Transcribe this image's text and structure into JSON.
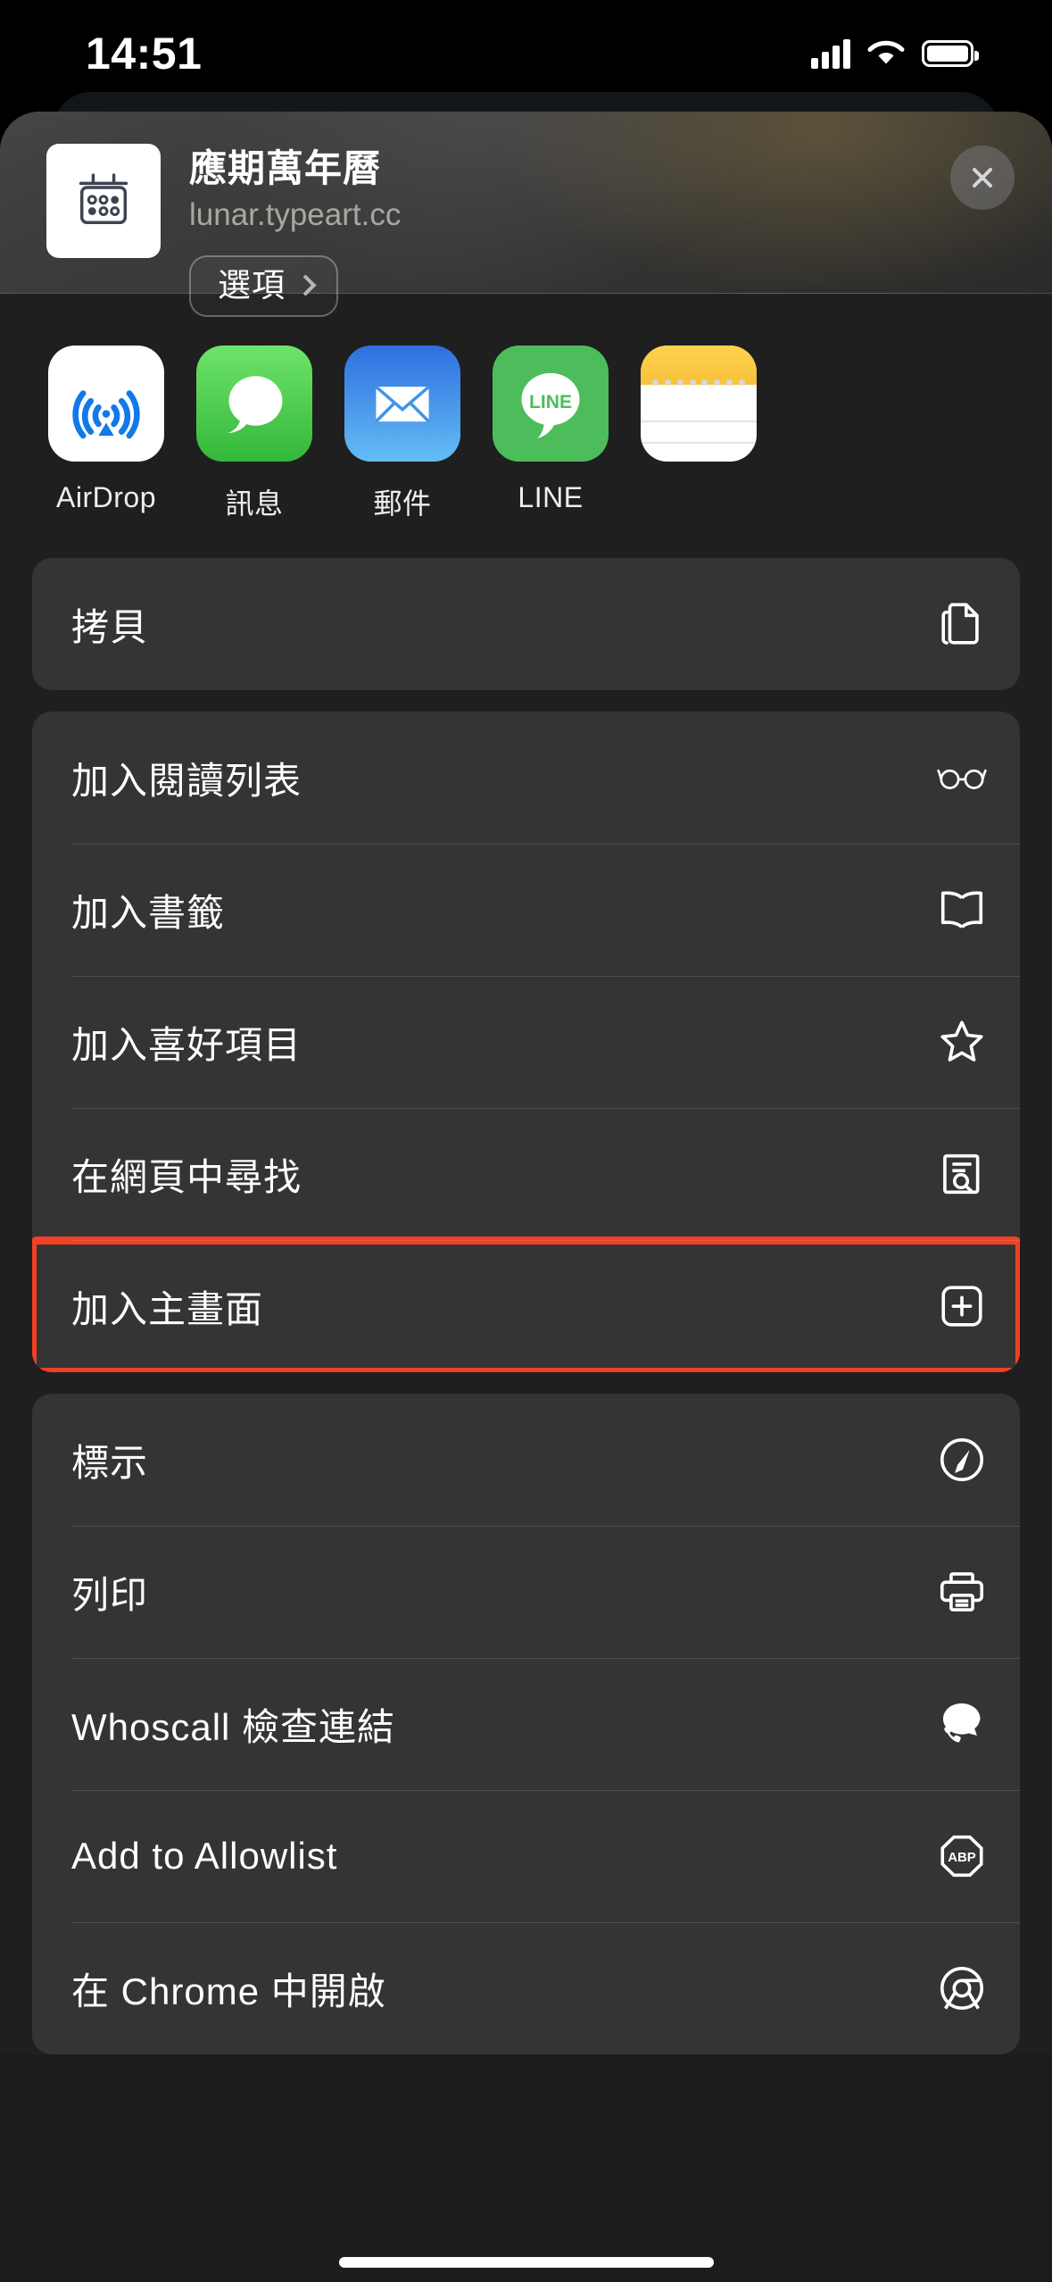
{
  "status_bar": {
    "time": "14:51",
    "cellular_icon": "cellular-signal-icon",
    "wifi_icon": "wifi-icon",
    "battery_icon": "battery-icon"
  },
  "share_sheet": {
    "header": {
      "app_icon": "calendar-app-icon",
      "title": "應期萬年曆",
      "url": "lunar.typeart.cc",
      "options_label": "選項",
      "options_chevron": "chevron-right-icon",
      "close_icon": "close-icon"
    },
    "apps": [
      {
        "label": "AirDrop",
        "icon": "airdrop-icon"
      },
      {
        "label": "訊息",
        "icon": "messages-icon"
      },
      {
        "label": "郵件",
        "icon": "mail-icon"
      },
      {
        "label": "LINE",
        "icon": "line-icon",
        "glyph_text": "LINE"
      },
      {
        "label": "",
        "icon": "notes-icon"
      }
    ],
    "action_groups": [
      {
        "rows": [
          {
            "label": "拷貝",
            "icon": "copy-icon",
            "highlighted": false
          }
        ]
      },
      {
        "rows": [
          {
            "label": "加入閱讀列表",
            "icon": "glasses-icon",
            "highlighted": false
          },
          {
            "label": "加入書籤",
            "icon": "book-icon",
            "highlighted": false
          },
          {
            "label": "加入喜好項目",
            "icon": "star-icon",
            "highlighted": false
          },
          {
            "label": "在網頁中尋找",
            "icon": "find-on-page-icon",
            "highlighted": false
          },
          {
            "label": "加入主畫面",
            "icon": "add-to-home-icon",
            "highlighted": true
          }
        ]
      },
      {
        "rows": [
          {
            "label": "標示",
            "icon": "markup-icon",
            "highlighted": false
          },
          {
            "label": "列印",
            "icon": "printer-icon",
            "highlighted": false
          },
          {
            "label": "Whoscall 檢查連結",
            "icon": "whoscall-icon",
            "highlighted": false
          },
          {
            "label": "Add to Allowlist",
            "icon": "adblock-icon",
            "highlighted": false
          },
          {
            "label": "在 Chrome 中開啟",
            "icon": "chrome-icon",
            "highlighted": false
          }
        ]
      }
    ],
    "highlight_color": "#f04026"
  }
}
